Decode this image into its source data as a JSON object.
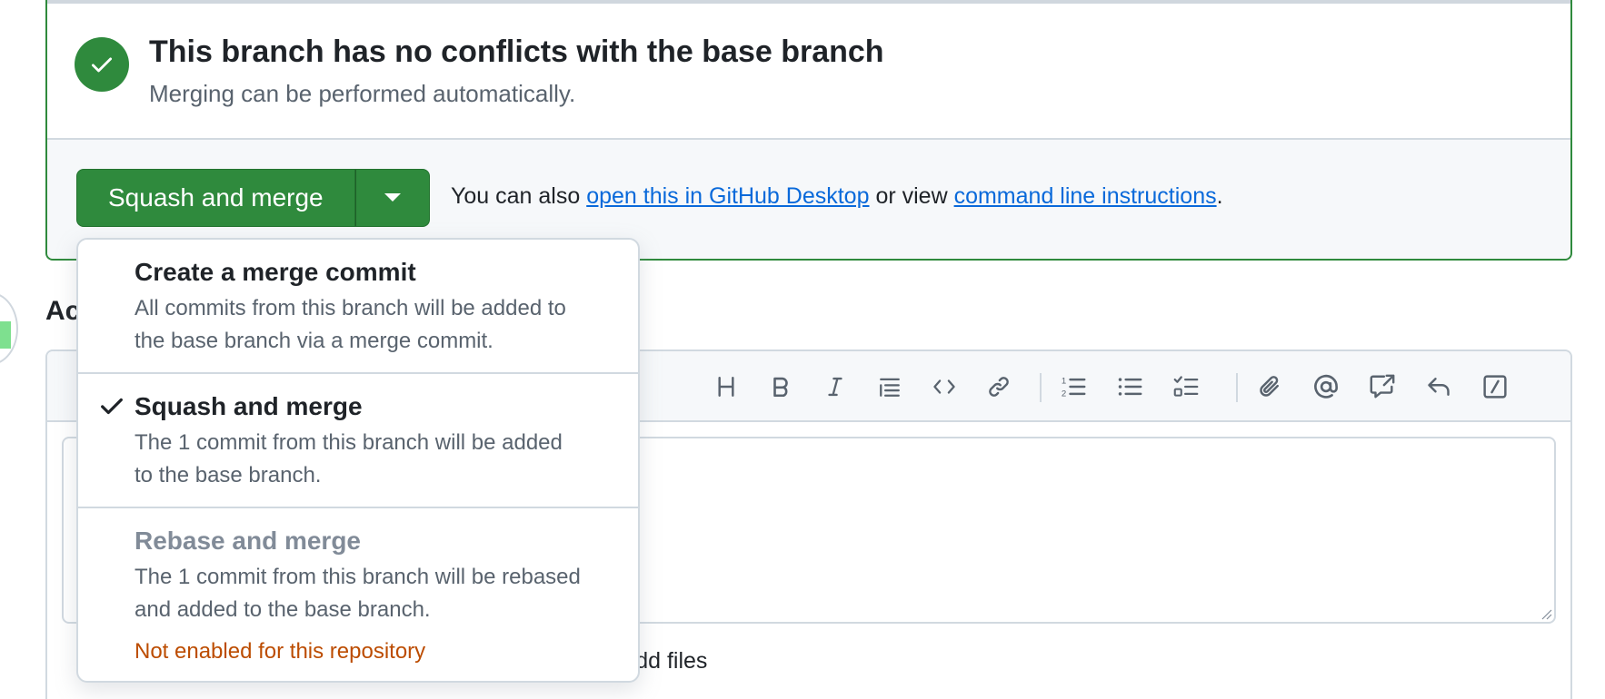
{
  "colors": {
    "success": "#2f8a3d",
    "link": "#0969da",
    "warning": "#bc4c00",
    "muted": "#59636e"
  },
  "status": {
    "title": "This branch has no conflicts with the base branch",
    "subtitle": "Merging can be performed automatically.",
    "icon": "check-circle-icon"
  },
  "merge": {
    "button_label": "Squash and merge",
    "caret_icon": "triangle-down-icon",
    "also_prefix": "You can also",
    "desktop_link": "open this in GitHub Desktop",
    "or_view": "or view",
    "cli_link": "command line instructions",
    "period": "."
  },
  "dropdown": {
    "items": [
      {
        "title": "Create a merge commit",
        "desc_line1": "All commits from this branch will be added to",
        "desc_line2": "the base branch via a merge commit.",
        "selected": false,
        "enabled": true
      },
      {
        "title": "Squash and merge",
        "desc_line1": "The 1 commit from this branch will be added",
        "desc_line2": "to the base branch.",
        "selected": true,
        "enabled": true
      },
      {
        "title": "Rebase and merge",
        "desc_line1": "The 1 commit from this branch will be rebased",
        "desc_line2": "and added to the base branch.",
        "selected": false,
        "enabled": false,
        "warning": "Not enabled for this repository"
      }
    ]
  },
  "comment": {
    "heading_partial": "Ac",
    "attach_text_partial": "ick to add files",
    "toolbar_icons": [
      "heading-icon",
      "bold-icon",
      "italic-icon",
      "quote-icon",
      "code-icon",
      "link-icon",
      "ordered-list-icon",
      "unordered-list-icon",
      "task-list-icon",
      "attach-icon",
      "mention-icon",
      "cross-reference-icon",
      "reply-icon",
      "slash-command-icon"
    ]
  }
}
